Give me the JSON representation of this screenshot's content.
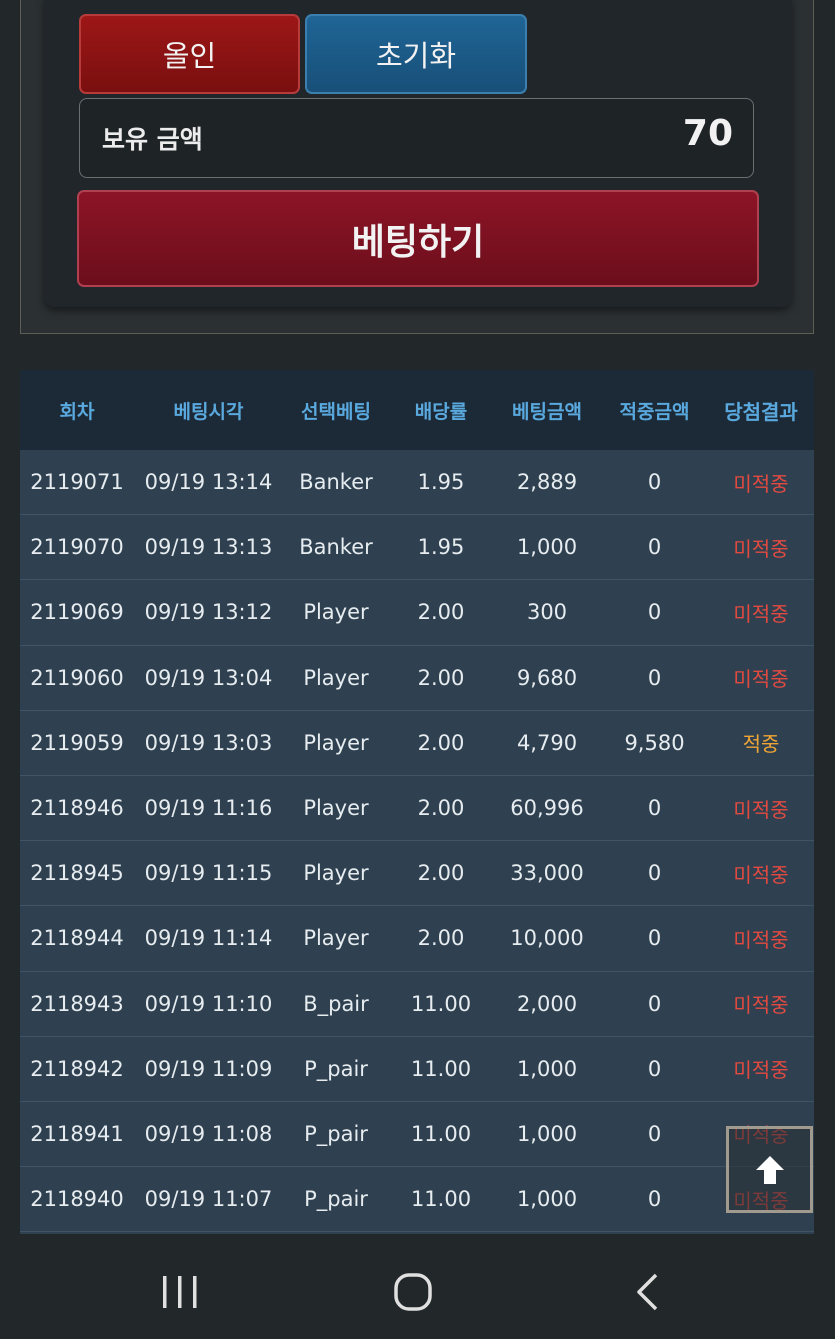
{
  "controls": {
    "allin_label": "올인",
    "reset_label": "초기화",
    "balance_label": "보유 금액",
    "balance_value": "70",
    "bet_label": "베팅하기"
  },
  "history": {
    "headers": [
      "회차",
      "베팅시각",
      "선택베팅",
      "배당률",
      "베팅금액",
      "적중금액",
      "당첨결과"
    ],
    "rows": [
      [
        "2119071",
        "09/19 13:14",
        "Banker",
        "1.95",
        "2,889",
        "0",
        "미적중"
      ],
      [
        "2119070",
        "09/19 13:13",
        "Banker",
        "1.95",
        "1,000",
        "0",
        "미적중"
      ],
      [
        "2119069",
        "09/19 13:12",
        "Player",
        "2.00",
        "300",
        "0",
        "미적중"
      ],
      [
        "2119060",
        "09/19 13:04",
        "Player",
        "2.00",
        "9,680",
        "0",
        "미적중"
      ],
      [
        "2119059",
        "09/19 13:03",
        "Player",
        "2.00",
        "4,790",
        "9,580",
        "적중"
      ],
      [
        "2118946",
        "09/19 11:16",
        "Player",
        "2.00",
        "60,996",
        "0",
        "미적중"
      ],
      [
        "2118945",
        "09/19 11:15",
        "Player",
        "2.00",
        "33,000",
        "0",
        "미적중"
      ],
      [
        "2118944",
        "09/19 11:14",
        "Player",
        "2.00",
        "10,000",
        "0",
        "미적중"
      ],
      [
        "2118943",
        "09/19 11:10",
        "B_pair",
        "11.00",
        "2,000",
        "0",
        "미적중"
      ],
      [
        "2118942",
        "09/19 11:09",
        "P_pair",
        "11.00",
        "1,000",
        "0",
        "미적중"
      ],
      [
        "2118941",
        "09/19 11:08",
        "P_pair",
        "11.00",
        "1,000",
        "0",
        "미적중"
      ],
      [
        "2118940",
        "09/19 11:07",
        "P_pair",
        "11.00",
        "1,000",
        "0",
        "미적중"
      ]
    ]
  },
  "colors": {
    "miss": "#e24a40",
    "hit": "#f0a536",
    "header_text": "#5aa9de"
  },
  "icons": {
    "scroll_top": "arrow-up-icon",
    "nav_recent": "recent-apps-icon",
    "nav_home": "home-icon",
    "nav_back": "back-icon"
  }
}
